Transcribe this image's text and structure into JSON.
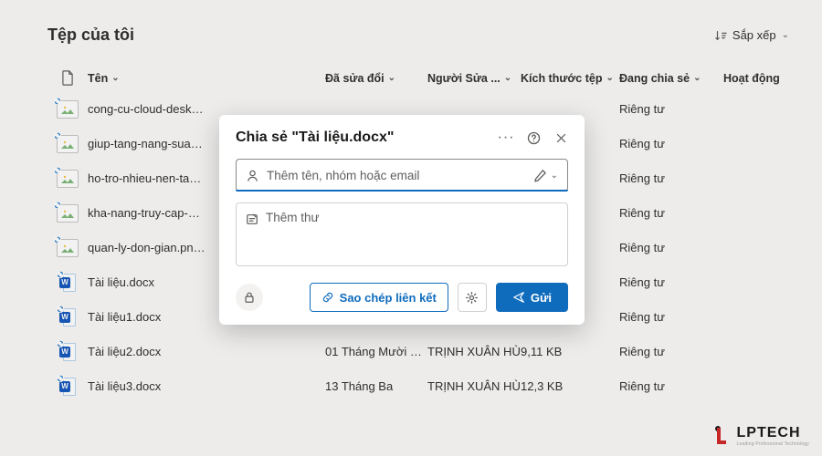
{
  "header": {
    "title": "Tệp của tôi",
    "sort_label": "Sắp xếp"
  },
  "columns": {
    "name": "Tên",
    "modified": "Đã sửa đổi",
    "modified_by": "Người Sửa ...",
    "size": "Kích thước tệp",
    "sharing": "Đang chia sẻ",
    "activity": "Hoạt động"
  },
  "files": [
    {
      "type": "image",
      "name": "cong-cu-cloud-desk…",
      "modified": "",
      "modified_by": "",
      "size": "",
      "sharing": "Riêng tư"
    },
    {
      "type": "image",
      "name": "giup-tang-nang-sua…",
      "modified": "",
      "modified_by": "",
      "size": "",
      "sharing": "Riêng tư"
    },
    {
      "type": "image",
      "name": "ho-tro-nhieu-nen-ta…",
      "modified": "",
      "modified_by": "",
      "size": "",
      "sharing": "Riêng tư"
    },
    {
      "type": "image",
      "name": "kha-nang-truy-cap-…",
      "modified": "",
      "modified_by": "",
      "size": "",
      "sharing": "Riêng tư"
    },
    {
      "type": "image",
      "name": "quan-ly-don-gian.pn…",
      "modified": "",
      "modified_by": "",
      "size": "",
      "sharing": "Riêng tư"
    },
    {
      "type": "word",
      "name": "Tài liệu.docx",
      "modified": "",
      "modified_by": "",
      "size": "",
      "sharing": "Riêng tư"
    },
    {
      "type": "word",
      "name": "Tài liệu1.docx",
      "modified": "",
      "modified_by": "",
      "size": "",
      "sharing": "Riêng tư"
    },
    {
      "type": "word",
      "name": "Tài liệu2.docx",
      "modified": "01 Tháng Mười …",
      "modified_by": "TRỊNH XUÂN HÙNG",
      "size": "9,11 KB",
      "sharing": "Riêng tư"
    },
    {
      "type": "word",
      "name": "Tài liệu3.docx",
      "modified": "13 Tháng Ba",
      "modified_by": "TRỊNH XUÂN HÙNG",
      "size": "12,3 KB",
      "sharing": "Riêng tư"
    }
  ],
  "modal": {
    "title": "Chia sẻ \"Tài liệu.docx\"",
    "recipient_placeholder": "Thêm tên, nhóm hoặc email",
    "message_placeholder": "Thêm thư",
    "copy_link_label": "Sao chép liên kết",
    "send_label": "Gửi"
  },
  "brand": {
    "name": "LPTECH",
    "tag": "Leading Professional Technology"
  }
}
